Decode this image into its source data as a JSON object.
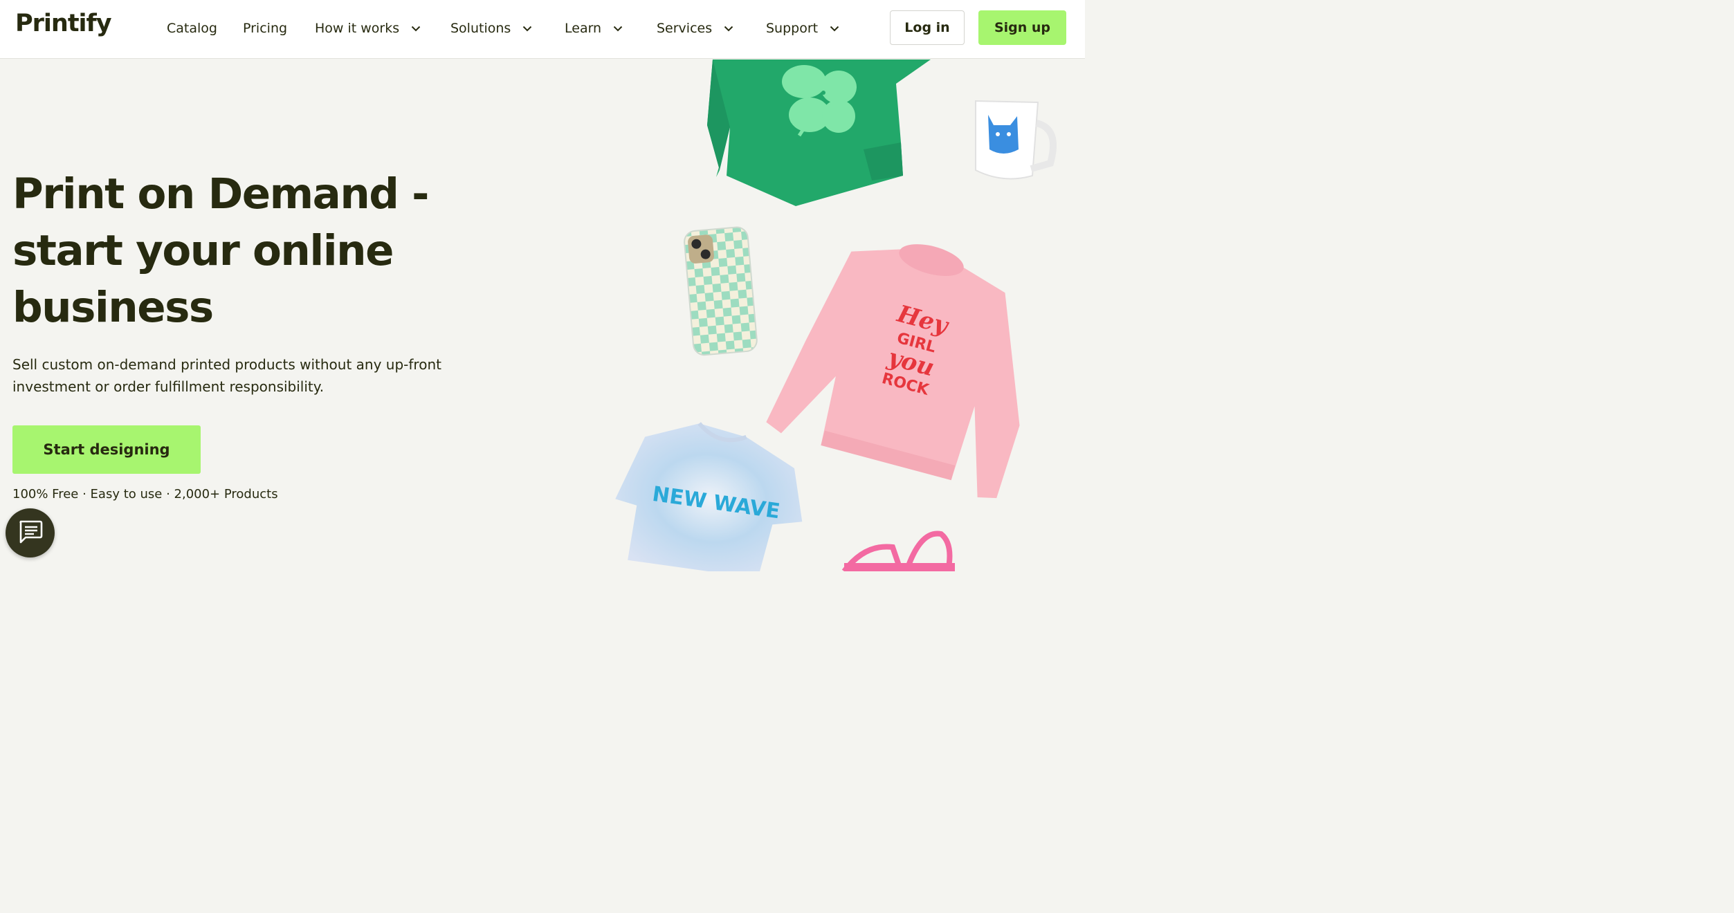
{
  "brand": {
    "name": "Printify"
  },
  "nav": {
    "items": [
      {
        "label": "Catalog",
        "dropdown": false
      },
      {
        "label": "Pricing",
        "dropdown": false
      },
      {
        "label": "How it works",
        "dropdown": true
      },
      {
        "label": "Solutions",
        "dropdown": true
      },
      {
        "label": "Learn",
        "dropdown": true
      },
      {
        "label": "Services",
        "dropdown": true
      },
      {
        "label": "Support",
        "dropdown": true
      }
    ],
    "login_label": "Log in",
    "signup_label": "Sign up"
  },
  "hero": {
    "headline": "Print on Demand - start your online business",
    "subtext": "Sell custom on-demand printed products without any up-front investment or order fulfillment responsibility.",
    "cta_label": "Start designing",
    "features": "100% Free · Easy to use · 2,000+ Products"
  },
  "products": {
    "pink_sweatshirt_print": [
      "Hey",
      "GIRL",
      "you",
      "ROCK"
    ],
    "tshirt_print": "NEW WAVE",
    "items": [
      "sweatshirt-icon",
      "mug-icon",
      "phone-case-icon",
      "sweatshirt-icon",
      "t-shirt-icon",
      "tote-bag-icon"
    ]
  },
  "colors": {
    "accent": "#a7f56f",
    "text": "#272a10",
    "background": "#f4f4f0",
    "chat_button": "#34351f"
  }
}
